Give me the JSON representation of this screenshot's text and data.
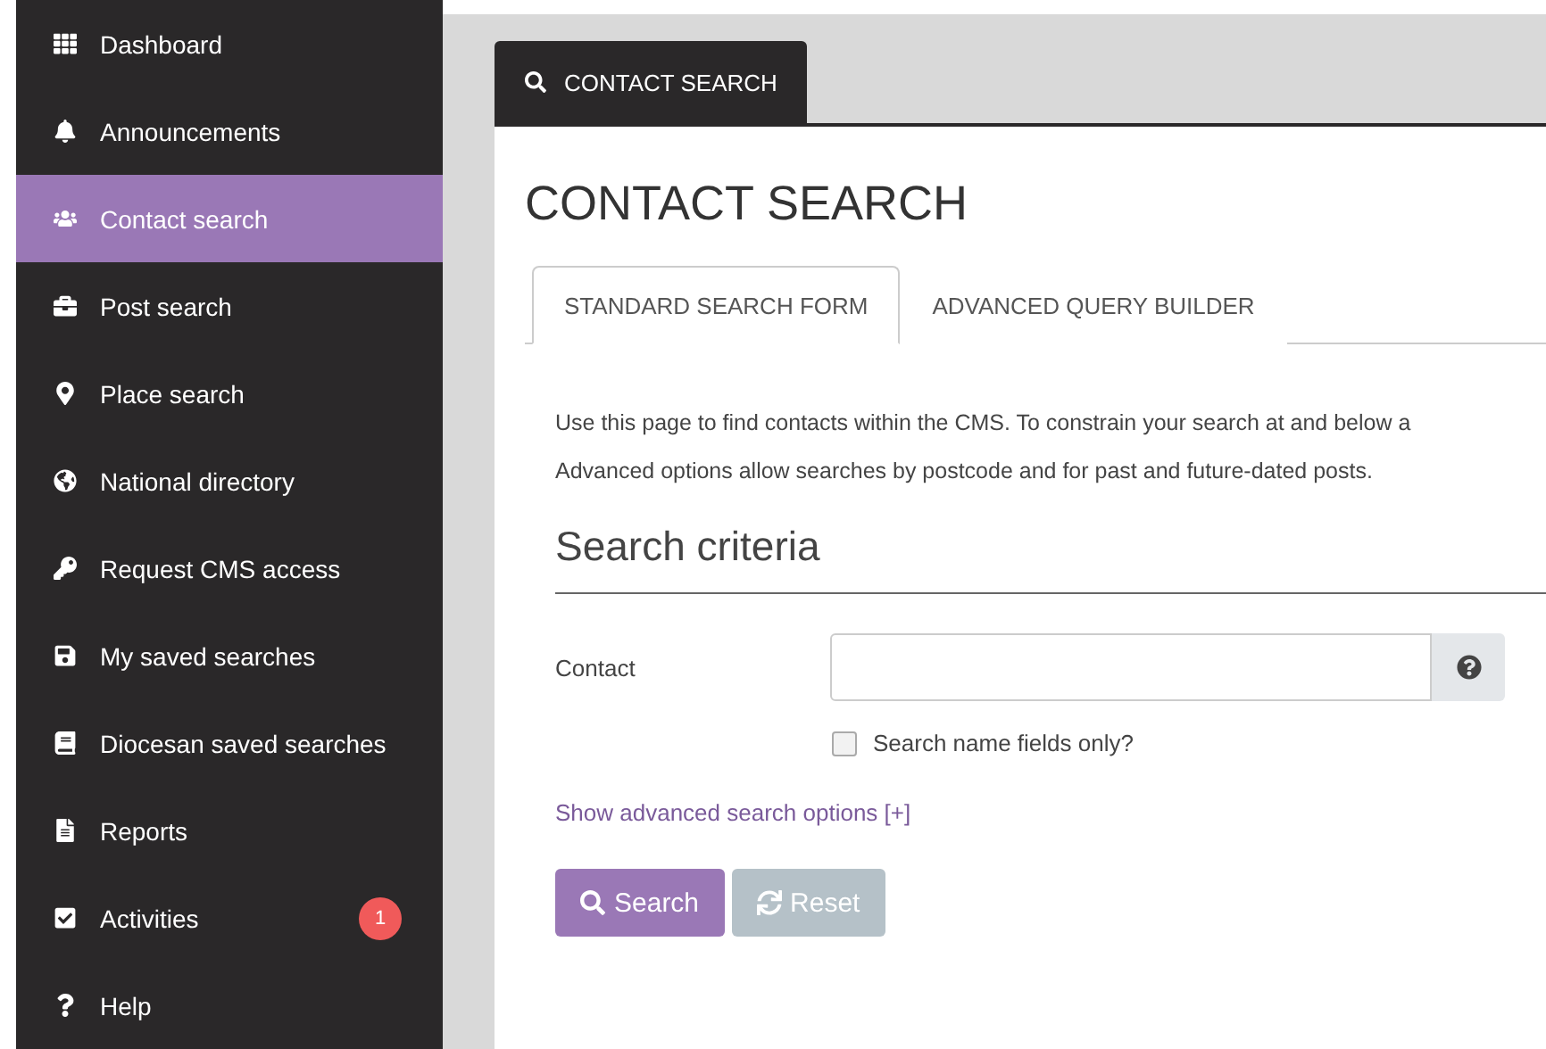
{
  "sidebar": {
    "items": [
      {
        "label": "Dashboard",
        "selected": false
      },
      {
        "label": "Announcements",
        "selected": false
      },
      {
        "label": "Contact search",
        "selected": true
      },
      {
        "label": "Post search",
        "selected": false
      },
      {
        "label": "Place search",
        "selected": false
      },
      {
        "label": "National directory",
        "selected": false
      },
      {
        "label": "Request CMS access",
        "selected": false
      },
      {
        "label": "My saved searches",
        "selected": false
      },
      {
        "label": "Diocesan saved searches",
        "selected": false
      },
      {
        "label": "Reports",
        "selected": false
      },
      {
        "label": "Activities",
        "selected": false,
        "badge": "1"
      },
      {
        "label": "Help",
        "selected": false
      }
    ]
  },
  "page_tab": {
    "label": "CONTACT SEARCH"
  },
  "title": "CONTACT SEARCH",
  "tabs": [
    {
      "label": "STANDARD SEARCH FORM",
      "selected": true
    },
    {
      "label": "ADVANCED QUERY BUILDER",
      "selected": false
    }
  ],
  "intro": [
    "Use this page to find contacts within the CMS. To constrain your search at and below a",
    "Advanced options allow searches by postcode and for past and future-dated posts."
  ],
  "section_title": "Search criteria",
  "contact_field": {
    "label": "Contact"
  },
  "name_only": {
    "label": "Search name fields only?",
    "checked": false
  },
  "advanced_link": "Show advanced search options [+]",
  "buttons": [
    {
      "label": "Search",
      "kind": "primary",
      "disabled": false
    },
    {
      "label": "Reset",
      "kind": "reset",
      "disabled": true
    }
  ]
}
